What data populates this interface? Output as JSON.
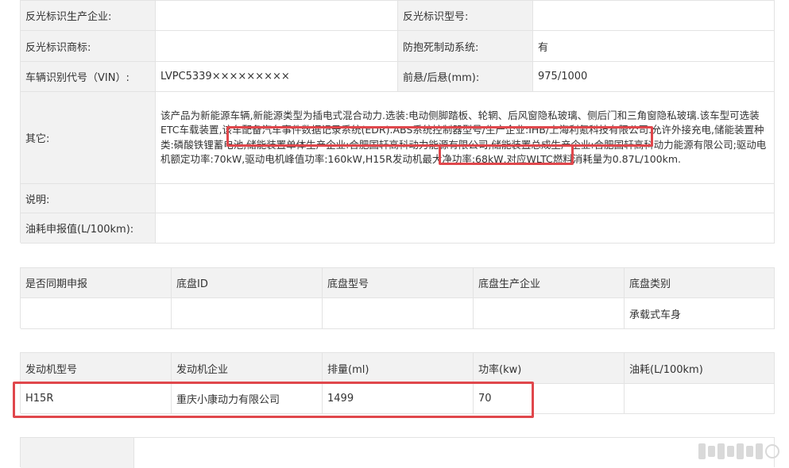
{
  "vehicle_table": {
    "rows": [
      {
        "label": "反光标识生产企业:",
        "value": "",
        "label2": "反光标识型号:",
        "value2": ""
      },
      {
        "label": "反光标识商标:",
        "value": "",
        "label2": "防抱死制动系统:",
        "value2": "有"
      },
      {
        "label": "车辆识别代号（VIN）:",
        "value": "LVPC5339×××××××××",
        "label2": "前悬/后悬(mm):",
        "value2": "975/1000"
      }
    ],
    "other_label": "其它:",
    "other_text": "该产品为新能源车辆,新能源类型为插电式混合动力.选装:电动侧脚踏板、轮辋、后风窗隐私玻璃、侧后门和三角窗隐私玻璃.该车型可选装ETC车载装置,该车配备汽车事件数据记录系统(EDR).ABS系统控制器型号/生产企业:IHB/上海利氪科技有限公司.允许外接充电,储能装置种类:磷酸铁锂蓄电池,储能装置单体生产企业:合肥国轩高科动力能源有限公司,储能装置总成生产企业:合肥国轩高科动力能源有限公司;驱动电机额定功率:70kW,驱动电机峰值功率:160kW,H15R发动机最大净功率:68kW,对应WLTC燃料消耗量为0.87L/100km.",
    "note_label": "说明:",
    "note_value": "",
    "fuel_label": "油耗申报值(L/100km):",
    "fuel_value": ""
  },
  "chassis_table": {
    "headers": [
      "是否同期申报",
      "底盘ID",
      "底盘型号",
      "底盘生产企业",
      "底盘类别"
    ],
    "row": [
      "",
      "",
      "",
      "",
      "承载式车身"
    ]
  },
  "engine_table": {
    "headers": [
      "发动机型号",
      "发动机企业",
      "排量(ml)",
      "功率(kw)",
      "油耗(L/100km)"
    ],
    "row": [
      "H15R",
      "重庆小康动力有限公司",
      "1499",
      "70",
      ""
    ]
  },
  "colors": {
    "highlight": "#e0474c",
    "header_bg": "#f2f2f2",
    "border": "#e3e3e3"
  }
}
